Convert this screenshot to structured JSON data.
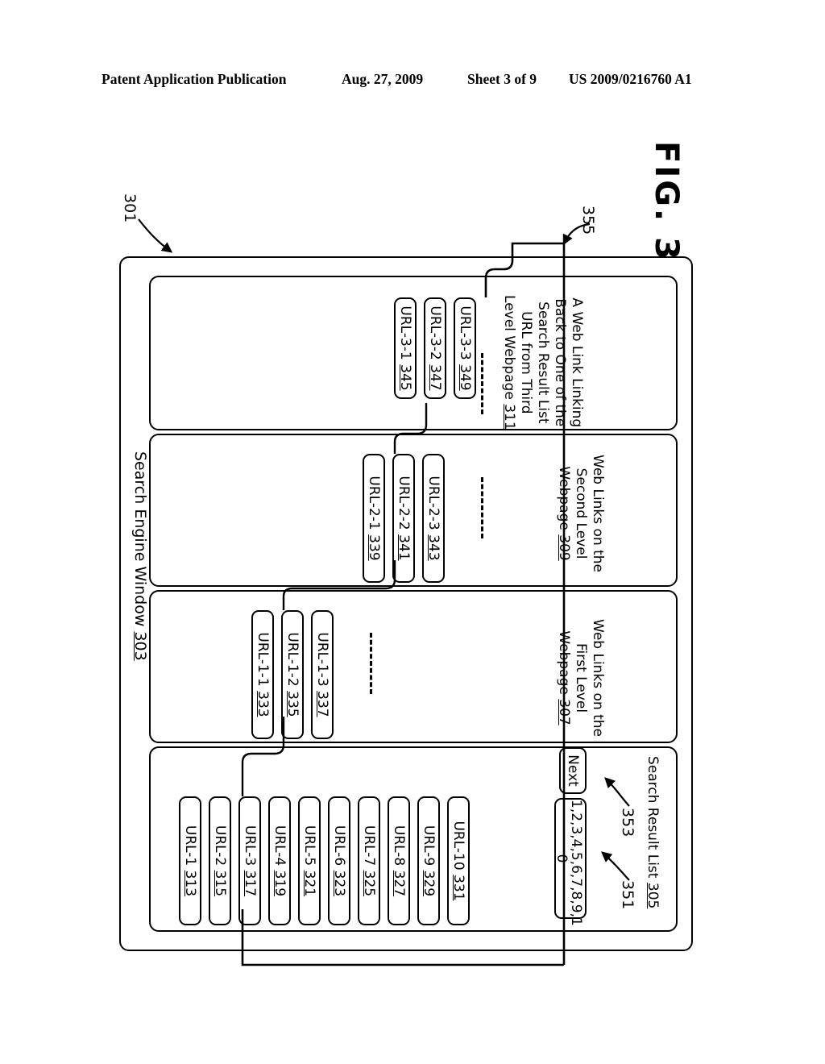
{
  "header": {
    "publication": "Patent Application Publication",
    "date": "Aug. 27, 2009",
    "sheet": "Sheet 3 of 9",
    "patent_number": "US 2009/0216760 A1"
  },
  "figure": {
    "caption": "FIG. 3",
    "diagram_ref": "301",
    "back_link_ref": "355"
  },
  "window": {
    "title": "Search Engine Window ",
    "title_ref": "303"
  },
  "third_level": {
    "caption_line1": "A Web Link Linking",
    "caption_line2": "Back to One of the",
    "caption_line3": "Search Result List",
    "caption_line4": "URL from Third",
    "caption_line5": "Level Webpage ",
    "caption_ref": "311",
    "links": [
      {
        "label": "URL-3-1 ",
        "ref": "345"
      },
      {
        "label": "URL-3-2 ",
        "ref": "347"
      },
      {
        "label": "URL-3-3 ",
        "ref": "349"
      }
    ]
  },
  "second_level": {
    "caption_line1": "Web Links on the",
    "caption_line2": "Second Level",
    "caption_line3": "Webpage ",
    "caption_ref": "309",
    "links": [
      {
        "label": "URL-2-1 ",
        "ref": "339"
      },
      {
        "label": "URL-2-2 ",
        "ref": "341"
      },
      {
        "label": "URL-2-3 ",
        "ref": "343"
      }
    ]
  },
  "first_level": {
    "caption_line1": "Web Links on the",
    "caption_line2": "First Level",
    "caption_line3": "Webpage ",
    "caption_ref": "307",
    "links": [
      {
        "label": "URL-1-1 ",
        "ref": "333"
      },
      {
        "label": "URL-1-2 ",
        "ref": "335"
      },
      {
        "label": "URL-1-3 ",
        "ref": "337"
      }
    ]
  },
  "search_results": {
    "caption": "Search Result List ",
    "caption_ref": "305",
    "links": [
      {
        "label": "URL-1 ",
        "ref": "313"
      },
      {
        "label": "URL-2 ",
        "ref": "315"
      },
      {
        "label": "URL-3 ",
        "ref": "317"
      },
      {
        "label": "URL-4 ",
        "ref": "319"
      },
      {
        "label": "URL-5 ",
        "ref": "321"
      },
      {
        "label": "URL-6 ",
        "ref": "323"
      },
      {
        "label": "URL-7 ",
        "ref": "325"
      },
      {
        "label": "URL-8 ",
        "ref": "327"
      },
      {
        "label": "URL-9 ",
        "ref": "329"
      },
      {
        "label": "URL-10 ",
        "ref": "331"
      }
    ],
    "pagination": {
      "label_line1": "1,2,3,4,5,6,7,8,9,1",
      "label_line2": "0",
      "ref": "351"
    },
    "next_button": {
      "label": "Next",
      "ref": "353"
    }
  }
}
